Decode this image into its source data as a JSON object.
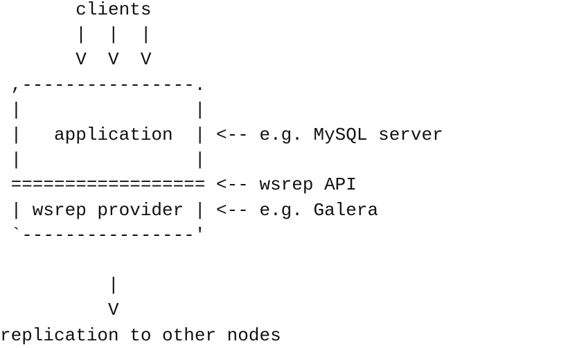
{
  "diagram": {
    "lines": [
      "       clients",
      "       |  |  |",
      "       V  V  V",
      " ,----------------.",
      " |                |",
      " |   application  | <-- e.g. MySQL server",
      " |                |",
      " ================== <-- wsrep API",
      " | wsrep provider | <-- e.g. Galera",
      " `----------------'",
      "",
      "          |",
      "          V",
      "replication to other nodes"
    ]
  }
}
